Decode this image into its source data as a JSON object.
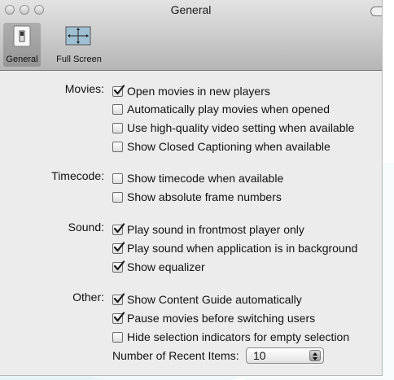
{
  "window": {
    "title": "General"
  },
  "toolbar": {
    "items": [
      {
        "label": "General",
        "icon": "switch-icon",
        "selected": true
      },
      {
        "label": "Full Screen",
        "icon": "full-screen-icon",
        "selected": false
      }
    ]
  },
  "movies": {
    "label": "Movies:",
    "options": [
      {
        "label": "Open movies in new players",
        "checked": true
      },
      {
        "label": "Automatically play movies when opened",
        "checked": false
      },
      {
        "label": "Use high-quality video setting when available",
        "checked": false
      },
      {
        "label": "Show Closed Captioning when available",
        "checked": false
      }
    ]
  },
  "timecode": {
    "label": "Timecode:",
    "options": [
      {
        "label": "Show timecode when available",
        "checked": false
      },
      {
        "label": "Show absolute frame numbers",
        "checked": false
      }
    ]
  },
  "sound": {
    "label": "Sound:",
    "options": [
      {
        "label": "Play sound in frontmost player only",
        "checked": true
      },
      {
        "label": "Play sound when application is in background",
        "checked": true
      },
      {
        "label": "Show equalizer",
        "checked": true
      }
    ]
  },
  "other": {
    "label": "Other:",
    "options": [
      {
        "label": "Show Content Guide automatically",
        "checked": true
      },
      {
        "label": "Pause movies before switching users",
        "checked": true
      },
      {
        "label": "Hide selection indicators for empty selection",
        "checked": false
      }
    ],
    "recent_items": {
      "label": "Number of Recent Items:",
      "value": "10"
    }
  },
  "colors": {
    "check": "#1a1a1a",
    "accent": "#6aa0d8"
  }
}
